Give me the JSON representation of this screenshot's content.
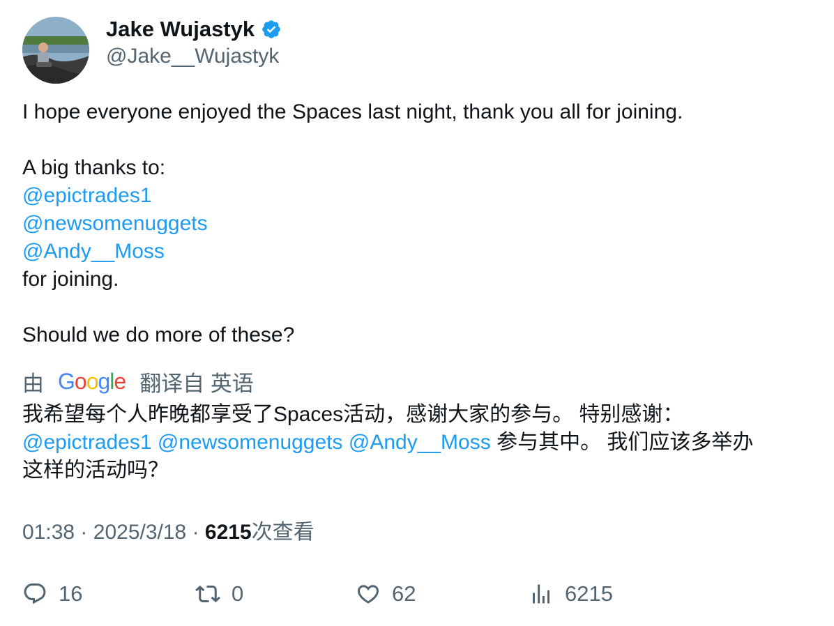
{
  "user": {
    "display_name": "Jake Wujastyk",
    "handle": "@Jake__Wujastyk",
    "verified": true,
    "verified_color": "#1d9bf0"
  },
  "tweet": {
    "line1": "I hope everyone enjoyed the Spaces last night, thank you all for joining.",
    "line2": "A big thanks to:",
    "mention1": "@epictrades1",
    "mention2": "@newsomenuggets",
    "mention3": "@Andy__Moss",
    "line3": "for joining.",
    "line4": "Should we do more of these?"
  },
  "translation": {
    "prefix": "由",
    "brand": "Google",
    "suffix": "翻译自 英语",
    "line1": "我希望每个人昨晚都享受了Spaces活动，感谢大家的参与。 特别感谢：",
    "mention1": "@epictrades1",
    "mention2": "@newsomenuggets",
    "mention3": "@Andy__Moss",
    "line2_tail": "参与其中。 我们应该多举办",
    "line3": "这样的活动吗？"
  },
  "meta": {
    "time": "01:38",
    "separator": "·",
    "date": "2025/3/18",
    "views_count": "6215",
    "views_label": "次查看"
  },
  "actions": {
    "replies": "16",
    "reposts": "0",
    "likes": "62",
    "views": "6215"
  },
  "colors": {
    "link": "#1d9bf0",
    "secondary_text": "#536471",
    "primary_text": "#0f1419"
  },
  "icons": [
    "reply-icon",
    "repost-icon",
    "like-icon",
    "views-icon",
    "verified-badge-icon"
  ]
}
